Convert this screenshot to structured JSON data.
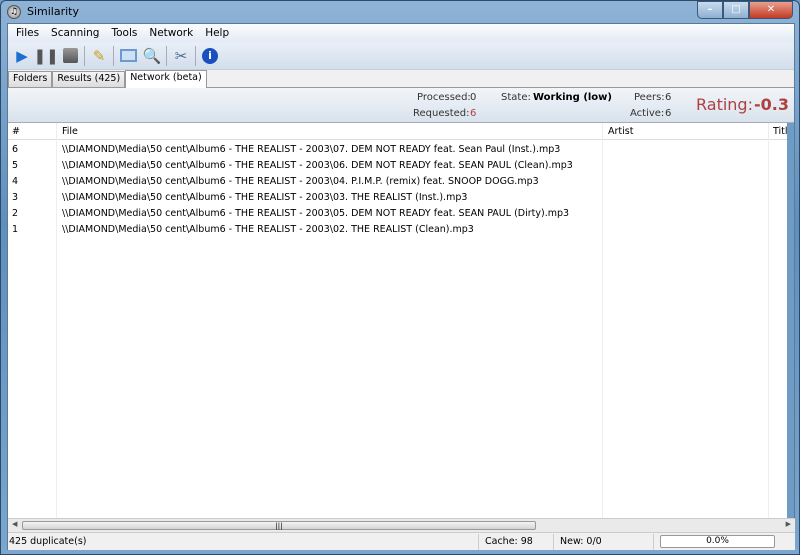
{
  "window": {
    "title": "Similarity",
    "controls": [
      "minimize",
      "maximize",
      "close"
    ]
  },
  "menu": [
    "Files",
    "Scanning",
    "Tools",
    "Network",
    "Help"
  ],
  "toolbar": [
    {
      "icon": "play-icon",
      "color": "#1a6fd0"
    },
    {
      "icon": "pause-icon"
    },
    {
      "icon": "stop-icon"
    },
    {
      "icon": "edit-icon"
    },
    {
      "icon": "display-icon"
    },
    {
      "icon": "search-icon"
    },
    {
      "icon": "tools-icon"
    },
    {
      "icon": "info-icon",
      "color": "#1a4fc0"
    }
  ],
  "tabs": [
    {
      "label": "Folders"
    },
    {
      "label": "Results (425)"
    },
    {
      "label": "Network (beta)",
      "active": true
    }
  ],
  "info": {
    "processed_label": "Processed:",
    "processed": "0",
    "requested_label": "Requested:",
    "requested": "6",
    "state_label": "State:",
    "state": "Working (low)",
    "peers_label": "Peers:",
    "peers": "6",
    "active_label": "Active:",
    "active": "6",
    "rating_label": "Rating:",
    "rating": "-0.3",
    "rating_color": "#b04040"
  },
  "table": {
    "columns": [
      "#",
      "File",
      "Artist",
      "Title"
    ],
    "rows": [
      {
        "n": "6",
        "file": "\\\\DIAMOND\\Media\\50 cent\\Album6 - THE REALIST - 2003\\07. DEM NOT READY feat. Sean Paul  (Inst.).mp3"
      },
      {
        "n": "5",
        "file": "\\\\DIAMOND\\Media\\50 cent\\Album6 - THE REALIST - 2003\\06. DEM NOT READY feat. SEAN PAUL (Clean).mp3"
      },
      {
        "n": "4",
        "file": "\\\\DIAMOND\\Media\\50 cent\\Album6 - THE REALIST - 2003\\04. P.I.M.P. (remix) feat. SNOOP DOGG.mp3"
      },
      {
        "n": "3",
        "file": "\\\\DIAMOND\\Media\\50 cent\\Album6 - THE REALIST - 2003\\03. THE REALIST (Inst.).mp3"
      },
      {
        "n": "2",
        "file": "\\\\DIAMOND\\Media\\50 cent\\Album6 - THE REALIST - 2003\\05. DEM NOT READY feat. SEAN PAUL (Dirty).mp3"
      },
      {
        "n": "1",
        "file": "\\\\DIAMOND\\Media\\50 cent\\Album6 - THE REALIST - 2003\\02. THE REALIST (Clean).mp3"
      }
    ]
  },
  "status": {
    "duplicates": "425 duplicate(s)",
    "cache": "Cache: 98",
    "new": "New: 0/0",
    "progress": "0.0%",
    "progress_value": 0
  }
}
